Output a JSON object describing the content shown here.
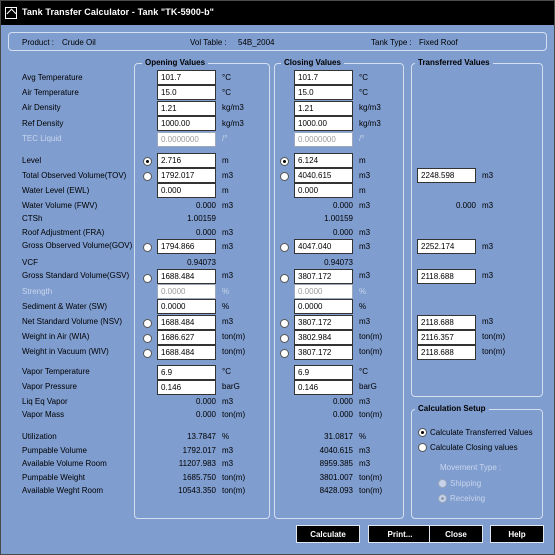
{
  "window": {
    "title": "Tank Transfer Calculator - Tank \"TK-5900-b\""
  },
  "info": {
    "product_label": "Product :",
    "product_value": "Crude Oil",
    "voltable_label": "Vol Table :",
    "voltable_value": "54B_2004",
    "tanktype_label": "Tank Type :",
    "tanktype_value": "Fixed Roof"
  },
  "headers": {
    "opening": "Opening Values",
    "closing": "Closing Values",
    "transferred": "Transferred Values",
    "calc_setup": "Calculation Setup"
  },
  "labels": {
    "avg_temp": "Avg Temperature",
    "air_temp": "Air Temperature",
    "air_density": "Air Density",
    "ref_density": "Ref Density",
    "tec_liquid": "TEC Liquid",
    "level": "Level",
    "tov": "Total Observed Volume(TOV)",
    "ewl": "Water Level (EWL)",
    "fwv": "Water Volume (FWV)",
    "ctsh": "CTSh",
    "fra": "Roof Adjustment (FRA)",
    "gov": "Gross Observed Volume(GOV)",
    "vcf": "VCF",
    "gsv": "Gross Standard Volume(GSV)",
    "strength": "Strength",
    "sw": "Sediment & Water (SW)",
    "nsv": "Net Standard Volume (NSV)",
    "wia": "Weight in Air (WIA)",
    "wiv": "Weight in Vacuum (WIV)",
    "vapor_temp": "Vapor Temperature",
    "vapor_pressure": "Vapor Pressure",
    "liq_eq": "Liq Eq Vapor",
    "vapor_mass": "Vapor Mass",
    "utilization": "Utilization",
    "pumpable_volume": "Pumpable Volume",
    "avail_vol_room": "Available Volume Room",
    "pumpable_weight": "Pumpable Weight",
    "avail_wt_room": "Available Weght Room"
  },
  "units": {
    "degc": "°C",
    "kgm3": "kg/m3",
    "per": "/°",
    "m": "m",
    "m3": "m3",
    "pct": "%",
    "tonm": "ton(m)",
    "barg": "barG"
  },
  "opening": {
    "avg_temp": "101.7",
    "air_temp": "15.0",
    "air_density": "1.21",
    "ref_density": "1000.00",
    "tec_liquid": "0.0000000",
    "level": "2.716",
    "tov": "1792.017",
    "ewl": "0.000",
    "fwv": "0.000",
    "ctsh": "1.00159",
    "fra": "0.000",
    "gov": "1794.866",
    "vcf": "0.94073",
    "gsv": "1688.484",
    "strength": "0.0000",
    "sw": "0.0000",
    "nsv": "1688.484",
    "wia": "1686.627",
    "wiv": "1688.484",
    "vapor_temp": "6.9",
    "vapor_pressure": "0.146",
    "liq_eq": "0.000",
    "vapor_mass": "0.000",
    "utilization": "13.7847",
    "pumpable_volume": "1792.017",
    "avail_vol_room": "11207.983",
    "pumpable_weight": "1685.750",
    "avail_wt_room": "10543.350"
  },
  "closing": {
    "avg_temp": "101.7",
    "air_temp": "15.0",
    "air_density": "1.21",
    "ref_density": "1000.00",
    "tec_liquid": "0.0000000",
    "level": "6.124",
    "tov": "4040.615",
    "ewl": "0.000",
    "fwv": "0.000",
    "ctsh": "1.00159",
    "fra": "0.000",
    "gov": "4047.040",
    "vcf": "0.94073",
    "gsv": "3807.172",
    "strength": "0.0000",
    "sw": "0.0000",
    "nsv": "3807.172",
    "wia": "3802.984",
    "wiv": "3807.172",
    "vapor_temp": "6.9",
    "vapor_pressure": "0.146",
    "liq_eq": "0.000",
    "vapor_mass": "0.000",
    "utilization": "31.0817",
    "pumpable_volume": "4040.615",
    "avail_vol_room": "8959.385",
    "pumpable_weight": "3801.007",
    "avail_wt_room": "8428.093"
  },
  "transferred": {
    "tov": "2248.598",
    "fwv": "0.000",
    "gov": "2252.174",
    "gsv": "2118.688",
    "nsv": "2118.688",
    "wia": "2116.357",
    "wiv": "2118.688"
  },
  "calc_setup": {
    "opt_transferred": "Calculate Transferred Values",
    "opt_closing": "Calculate Closing values",
    "movement_type": "Movement Type :",
    "shipping": "Shipping",
    "receiving": "Receiving"
  },
  "buttons": {
    "calculate": "Calculate",
    "print": "Print...",
    "close": "Close",
    "help": "Help"
  },
  "colors": {
    "background": "#7f9dcf",
    "titlebar": "#000000",
    "button": "#000000"
  }
}
